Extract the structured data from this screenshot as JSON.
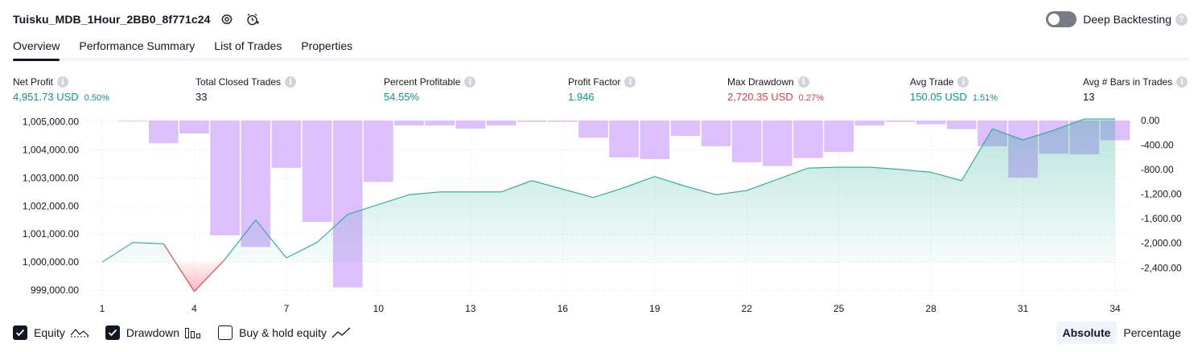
{
  "header": {
    "strategy_name": "Tuisku_MDB_1Hour_2BB0_8f771c24",
    "deep_backtesting_label": "Deep Backtesting",
    "deep_backtesting_enabled": false,
    "help_glyph": "?"
  },
  "tabs": [
    {
      "label": "Overview",
      "active": true
    },
    {
      "label": "Performance Summary",
      "active": false
    },
    {
      "label": "List of Trades",
      "active": false
    },
    {
      "label": "Properties",
      "active": false
    }
  ],
  "info_glyph": "i",
  "metrics": [
    {
      "label": "Net Profit",
      "value": "4,951.73 USD",
      "pct": "0.50%",
      "color": "#089981"
    },
    {
      "label": "Total Closed Trades",
      "value": "33",
      "pct": "",
      "color": "#131722"
    },
    {
      "label": "Percent Profitable",
      "value": "54.55%",
      "pct": "",
      "color": "#089981"
    },
    {
      "label": "Profit Factor",
      "value": "1.946",
      "pct": "",
      "color": "#089981"
    },
    {
      "label": "Max Drawdown",
      "value": "2,720.35 USD",
      "pct": "0.27%",
      "color": "#f23645"
    },
    {
      "label": "Avg Trade",
      "value": "150.05 USD",
      "pct": "1.51%",
      "color": "#089981"
    },
    {
      "label": "Avg # Bars in Trades",
      "value": "13",
      "pct": "",
      "color": "#131722"
    }
  ],
  "chart_data": {
    "type": "line",
    "x_ticks": [
      "1",
      "4",
      "7",
      "10",
      "13",
      "16",
      "19",
      "22",
      "25",
      "28",
      "31",
      "34"
    ],
    "y_left_ticks": [
      "1,005,000.00",
      "1,004,000.00",
      "1,003,000.00",
      "1,002,000.00",
      "1,001,000.00",
      "1,000,000.00",
      "999,000.00"
    ],
    "y_right_ticks": [
      "0.00",
      "-400.00",
      "-800.00",
      "-1,200.00",
      "-1,600.00",
      "-2,000.00",
      "-2,400.00"
    ],
    "y_left_range": [
      998800,
      1005100
    ],
    "y_right_range": [
      -2750,
      0
    ],
    "baseline": 1000000,
    "x": [
      1,
      2,
      3,
      4,
      5,
      6,
      7,
      8,
      9,
      10,
      11,
      12,
      13,
      14,
      15,
      16,
      17,
      18,
      19,
      20,
      21,
      22,
      23,
      24,
      25,
      26,
      27,
      28,
      29,
      30,
      31,
      32,
      33,
      34
    ],
    "series": [
      {
        "name": "Equity",
        "type": "area",
        "values": [
          1000000,
          1000700,
          1000650,
          998950,
          1000100,
          1001500,
          1000150,
          1000700,
          1001700,
          1002050,
          1002400,
          1002500,
          1002500,
          1002500,
          1002900,
          1002600,
          1002300,
          1002650,
          1003050,
          1002700,
          1002400,
          1002550,
          1002950,
          1003350,
          1003380,
          1003380,
          1003300,
          1003200,
          1002900,
          1004750,
          1004350,
          1004700,
          1005100,
          1005100
        ]
      },
      {
        "name": "Drawdown",
        "type": "bar",
        "values": [
          0,
          -370,
          -210,
          -1870,
          -2060,
          -770,
          -1650,
          -2720,
          -1000,
          -80,
          -80,
          -130,
          -80,
          -20,
          -20,
          -280,
          -600,
          -630,
          -250,
          -420,
          -680,
          -740,
          -610,
          -510,
          -80,
          -20,
          -60,
          -140,
          -420,
          -930,
          -540,
          -550,
          -320,
          -350
        ]
      }
    ],
    "legend": [
      {
        "label": "Equity",
        "checked": true,
        "icon": "equity-line-icon"
      },
      {
        "label": "Drawdown",
        "checked": true,
        "icon": "drawdown-bars-icon"
      },
      {
        "label": "Buy & hold equity",
        "checked": false,
        "icon": "buy-hold-line-icon"
      }
    ],
    "grid": true,
    "colors": {
      "equity_line": "#22ab94",
      "equity_fill": "#22ab94",
      "loss_fill": "#f23645",
      "drawdown_bar": "#d6b4fc",
      "grid": "#e0e3eb"
    }
  },
  "modes": [
    {
      "label": "Absolute",
      "active": true
    },
    {
      "label": "Percentage",
      "active": false
    }
  ]
}
